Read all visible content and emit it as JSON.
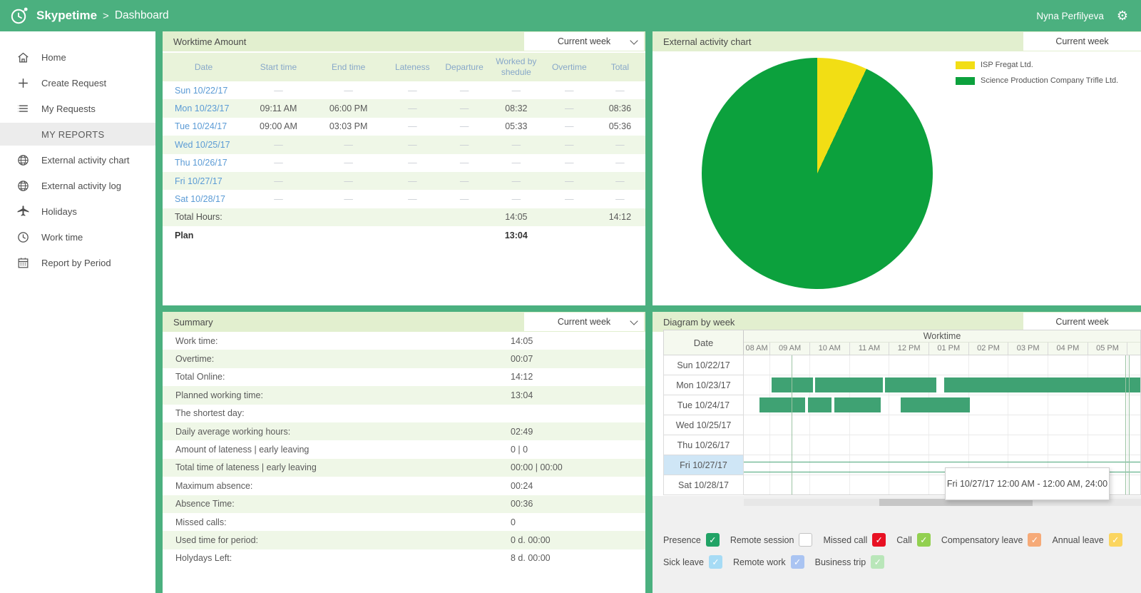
{
  "header": {
    "app_title": "Skypetime",
    "breadcrumb_separator": ">",
    "page_title": "Dashboard",
    "user_name": "Nyna Perfilyeva"
  },
  "sidebar": {
    "items": [
      {
        "label": "Home",
        "icon": "home"
      },
      {
        "label": "Create Request",
        "icon": "plus"
      },
      {
        "label": "My Requests",
        "icon": "list"
      },
      {
        "label": "MY REPORTS",
        "icon": null,
        "section": true
      },
      {
        "label": "External activity chart",
        "icon": "globe"
      },
      {
        "label": "External activity log",
        "icon": "globe"
      },
      {
        "label": "Holidays",
        "icon": "plane"
      },
      {
        "label": "Work time",
        "icon": "clock"
      },
      {
        "label": "Report by Period",
        "icon": "calendar"
      }
    ]
  },
  "panels": {
    "worktime": {
      "title": "Worktime Amount",
      "period": "Current week",
      "columns": [
        "Date",
        "Start time",
        "End time",
        "Lateness",
        "Departure",
        "Worked by shedule",
        "Overtime",
        "Total"
      ],
      "rows": [
        {
          "date": "Sun 10/22/17",
          "kind": "data",
          "cells": [
            "—",
            "—",
            "—",
            "—",
            "—",
            "—",
            "—"
          ]
        },
        {
          "date": "Mon 10/23/17",
          "kind": "data",
          "cells": [
            "09:11 AM",
            "06:00 PM",
            "—",
            "—",
            "08:32",
            "—",
            "08:36"
          ]
        },
        {
          "date": "Tue 10/24/17",
          "kind": "data",
          "cells": [
            "09:00 AM",
            "03:03 PM",
            "—",
            "—",
            "05:33",
            "—",
            "05:36"
          ]
        },
        {
          "date": "Wed 10/25/17",
          "kind": "data",
          "cells": [
            "—",
            "—",
            "—",
            "—",
            "—",
            "—",
            "—"
          ]
        },
        {
          "date": "Thu 10/26/17",
          "kind": "data",
          "cells": [
            "—",
            "—",
            "—",
            "—",
            "—",
            "—",
            "—"
          ]
        },
        {
          "date": "Fri 10/27/17",
          "kind": "data",
          "cells": [
            "—",
            "—",
            "—",
            "—",
            "—",
            "—",
            "—"
          ]
        },
        {
          "date": "Sat 10/28/17",
          "kind": "data",
          "cells": [
            "—",
            "—",
            "—",
            "—",
            "—",
            "—",
            "—"
          ]
        },
        {
          "date": "Total Hours:",
          "kind": "total",
          "cells": [
            "",
            "",
            "",
            "",
            "14:05",
            "",
            "14:12"
          ]
        },
        {
          "date": "Plan",
          "kind": "plan",
          "cells": [
            "",
            "",
            "",
            "",
            "13:04",
            "",
            ""
          ]
        }
      ]
    },
    "pie": {
      "title": "External activity chart",
      "period": "Current week",
      "legend": [
        {
          "label": "ISP Fregat Ltd.",
          "color": "#f2de14"
        },
        {
          "label": "Science Production Company Trifle Ltd.",
          "color": "#0ca13d"
        }
      ]
    },
    "summary": {
      "title": "Summary",
      "period": "Current week",
      "rows": [
        {
          "label": "Work time:",
          "value": "14:05"
        },
        {
          "label": "Overtime:",
          "value": "00:07"
        },
        {
          "label": "Total Online:",
          "value": "14:12"
        },
        {
          "label": "Planned working time:",
          "value": "13:04"
        },
        {
          "label": "The shortest day:",
          "value": ""
        },
        {
          "label": "Daily average working hours:",
          "value": "02:49"
        },
        {
          "label": "Amount of lateness | early leaving",
          "value": "0 | 0"
        },
        {
          "label": "Total time of lateness | early leaving",
          "value": "00:00 | 00:00"
        },
        {
          "label": "Maximum absence:",
          "value": "00:24"
        },
        {
          "label": "Absence Time:",
          "value": "00:36"
        },
        {
          "label": "Missed calls:",
          "value": "0"
        },
        {
          "label": "Used time for period:",
          "value": "0 d. 00:00"
        },
        {
          "label": "Holydays Left:",
          "value": "8 d. 00:00"
        }
      ]
    },
    "diagram": {
      "title": "Diagram by week",
      "period": "Current week",
      "date_header": "Date",
      "group_header": "Worktime",
      "tooltip": "Fri 10/27/17 12:00 AM - 12:00 AM, 24:00",
      "legend_rows": [
        [
          {
            "label": "Presence",
            "color": "#21a366",
            "checked": true
          },
          {
            "label": "Remote session",
            "color": "#ffffff",
            "checked": false
          },
          {
            "label": "Missed call",
            "color": "#e81123",
            "checked": true
          },
          {
            "label": "Call",
            "color": "#92d050",
            "checked": true
          },
          {
            "label": "Compensatory leave",
            "color": "#f6aa78",
            "checked": true
          },
          {
            "label": "Annual leave",
            "color": "#fbd55f",
            "checked": true
          }
        ],
        [
          {
            "label": "Sick leave",
            "color": "#a6dbf5",
            "checked": true
          },
          {
            "label": "Remote work",
            "color": "#aac4f2",
            "checked": true
          },
          {
            "label": "Business trip",
            "color": "#b9e6b9",
            "checked": true
          }
        ]
      ]
    }
  },
  "chart_data": [
    {
      "type": "pie",
      "title": "External activity chart",
      "legend_position": "top-right",
      "series": [
        {
          "name": "ISP Fregat Ltd.",
          "value": 7,
          "color": "#f2de14"
        },
        {
          "name": "Science Production Company Trifle Ltd.",
          "value": 93,
          "color": "#0ca13d"
        }
      ]
    },
    {
      "type": "gantt",
      "title": "Diagram by week",
      "group_header": "Worktime",
      "window_hours": [
        8.35,
        18.35
      ],
      "hour_ticks": [
        {
          "hour": 8,
          "label": "08 AM"
        },
        {
          "hour": 9,
          "label": "09 AM"
        },
        {
          "hour": 10,
          "label": "10 AM"
        },
        {
          "hour": 11,
          "label": "11 AM"
        },
        {
          "hour": 12,
          "label": "12 PM"
        },
        {
          "hour": 13,
          "label": "01 PM"
        },
        {
          "hour": 14,
          "label": "02 PM"
        },
        {
          "hour": 15,
          "label": "03 PM"
        },
        {
          "hour": 16,
          "label": "04 PM"
        },
        {
          "hour": 17,
          "label": "05 PM"
        },
        {
          "hour": 18,
          "label": ""
        }
      ],
      "bar_color": "#3fa273",
      "time_markers": [
        9.55,
        17.95,
        18.05
      ],
      "rows": [
        {
          "date": "Sun 10/22/17",
          "bars": []
        },
        {
          "date": "Mon 10/23/17",
          "bars": [
            [
              9.05,
              10.1
            ],
            [
              10.15,
              11.85
            ],
            [
              11.9,
              13.2
            ],
            [
              13.4,
              18.35
            ]
          ]
        },
        {
          "date": "Tue 10/24/17",
          "bars": [
            [
              8.75,
              9.9
            ],
            [
              9.97,
              10.55
            ],
            [
              10.63,
              11.8
            ],
            [
              12.3,
              14.05
            ]
          ]
        },
        {
          "date": "Wed 10/25/17",
          "bars": []
        },
        {
          "date": "Thu 10/26/17",
          "bars": []
        },
        {
          "date": "Fri 10/27/17",
          "bars": [],
          "selected": true,
          "full_day_outline": true
        },
        {
          "date": "Sat 10/28/17",
          "bars": []
        }
      ]
    }
  ]
}
